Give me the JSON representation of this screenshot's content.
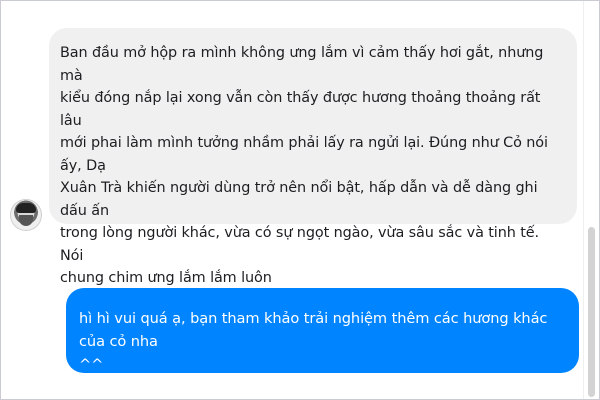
{
  "conversation": {
    "received_message": "Ban đầu mở hộp ra mình không ưng lắm vì cảm thấy hơi gắt, nhưng mà\nkiểu đóng nắp lại xong vẫn còn thấy được hương thoảng thoảng rất lâu\nmới phai làm mình tưởng nhầm phải lấy ra ngửi lại. Đúng như Cỏ nói ấy, Dạ\nXuân Trà khiến người dùng trở nên nổi bật, hấp dẫn và dễ dàng ghi dấu ấn\ntrong lòng người khác, vừa có sự ngọt ngào, vừa sâu sắc và tinh tế. Nói\nchung chim ưng lắm lắm luôn",
    "sent_message": "hì hì vui quá ạ, bạn tham khảo trải nghiệm thêm các hương khác của cỏ nha\n^^"
  },
  "colors": {
    "received_bubble": "#f1f0f0",
    "sent_bubble": "#0084ff",
    "sent_text": "#ffffff",
    "received_text": "#1c1e21"
  }
}
